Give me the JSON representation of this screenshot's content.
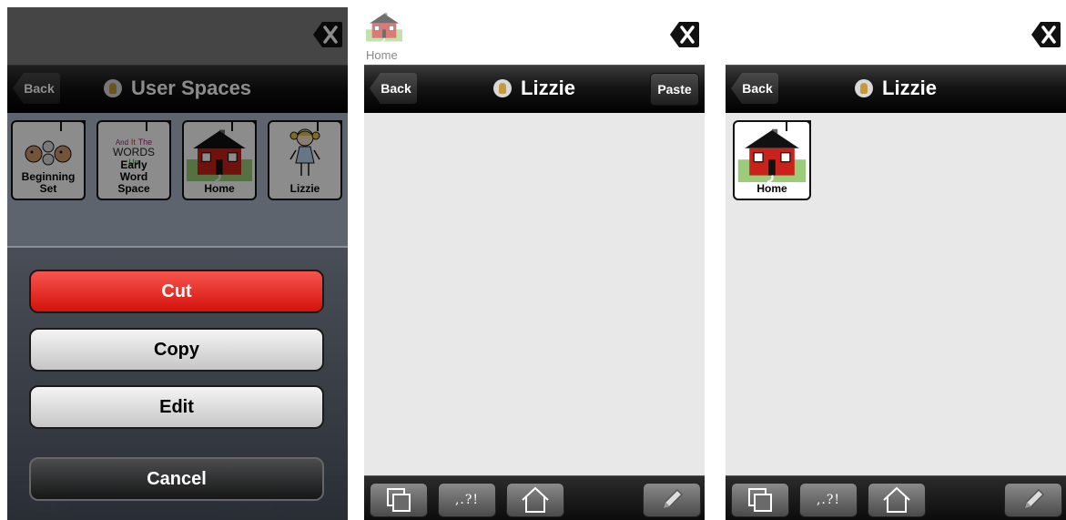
{
  "screens": [
    {
      "nav": {
        "back_label": "Back",
        "title": "User Spaces"
      },
      "tiles": [
        {
          "label": "Beginning Set",
          "icon": "faces-icon"
        },
        {
          "label": "Early Word Space",
          "icon": "words-icon",
          "art_words": [
            "And",
            "It",
            "The",
            "WORDS",
            "Up"
          ]
        },
        {
          "label": "Home",
          "icon": "house-icon"
        },
        {
          "label": "Lizzie",
          "icon": "girl-icon"
        }
      ],
      "action_sheet": {
        "cut": "Cut",
        "copy": "Copy",
        "edit": "Edit",
        "cancel": "Cancel"
      },
      "toolbar": {
        "add": "+",
        "done": "✓"
      }
    },
    {
      "message_bar": {
        "item_label": "Home"
      },
      "nav": {
        "back_label": "Back",
        "title": "Lizzie",
        "paste_label": "Paste"
      },
      "toolbar": {
        "punct_label": ",.?!"
      }
    },
    {
      "nav": {
        "back_label": "Back",
        "title": "Lizzie"
      },
      "tiles": [
        {
          "label": "Home",
          "icon": "house-icon"
        }
      ],
      "toolbar": {
        "punct_label": ",.?!"
      }
    }
  ],
  "colors": {
    "cut_red": "#e8241c",
    "nav_black": "#111111",
    "house_red": "#c8221a",
    "grass_green": "#8fbf6a"
  }
}
